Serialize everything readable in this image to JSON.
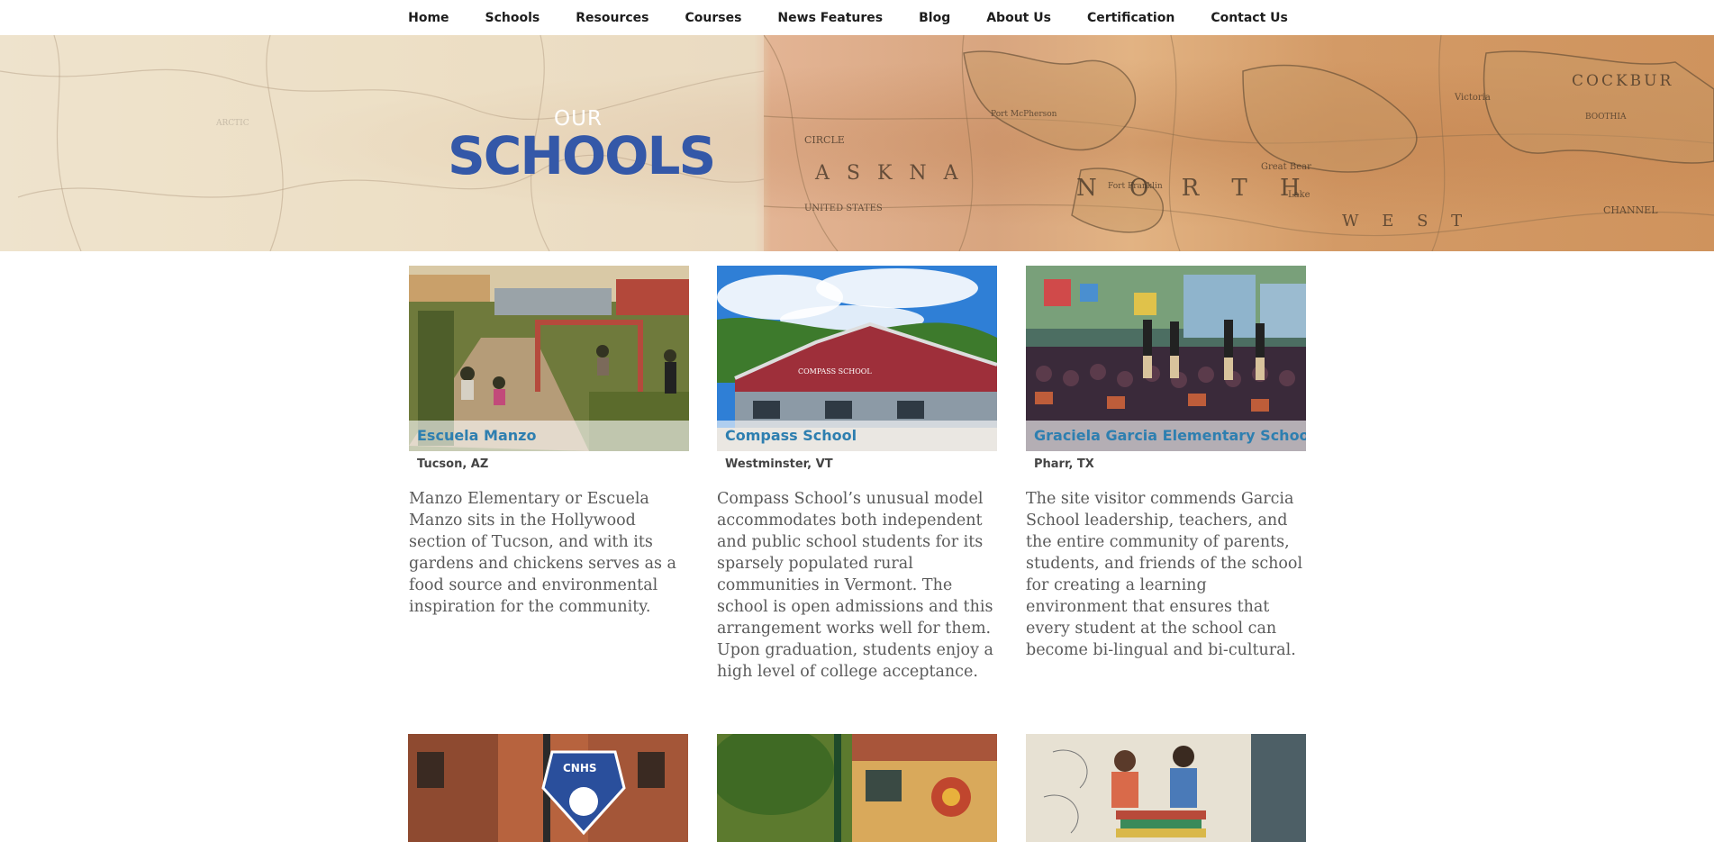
{
  "nav": {
    "items": [
      {
        "label": "Home"
      },
      {
        "label": "Schools"
      },
      {
        "label": "Resources"
      },
      {
        "label": "Courses"
      },
      {
        "label": "News Features"
      },
      {
        "label": "Blog"
      },
      {
        "label": "About Us"
      },
      {
        "label": "Certification"
      },
      {
        "label": "Contact Us"
      }
    ]
  },
  "hero": {
    "small_title": "OUR",
    "big_title": "SCHOOLS",
    "map_labels": [
      "CIRCLE",
      "A S K N A",
      "UNITED STATES",
      "N O R T H",
      "W E S T",
      "COCKBUR",
      "BOOTHIA",
      "Great Bear",
      "Fort Franklin",
      "Port McPherson",
      "Victoria",
      "CHANNEL",
      "ARCTIC",
      "Lake"
    ]
  },
  "schools": [
    {
      "name": "Escuela Manzo",
      "location": "Tucson, AZ",
      "description": "Manzo Elementary or Escuela Manzo sits in the Hollywood section of Tucson, and with its gardens and chickens serves as a food source and environmental inspiration for the community."
    },
    {
      "name": "Compass School",
      "location": "Westminster, VT",
      "description": "Compass School’s unusual model accommodates both independent and public school students for its sparsely populated rural communities in Vermont. The school is open admissions and this arrangement works well for them. Upon graduation, students enjoy a high level of college acceptance.",
      "sign_text": "COMPASS SCHOOL"
    },
    {
      "name": "Graciela Garcia Elementary School",
      "location": "Pharr, TX",
      "description": "The site visitor commends Garcia School leadership, teachers, and the entire community of parents, students, and friends of the school for creating a learning environment that ensures that every student at the school can become bi-lingual and bi-cultural."
    }
  ],
  "row2": {
    "sign_text": "CNHS"
  },
  "colors": {
    "accent_blue": "#3458a8",
    "school_name": "#2e7fb0",
    "body_text": "#5a5a5a"
  }
}
